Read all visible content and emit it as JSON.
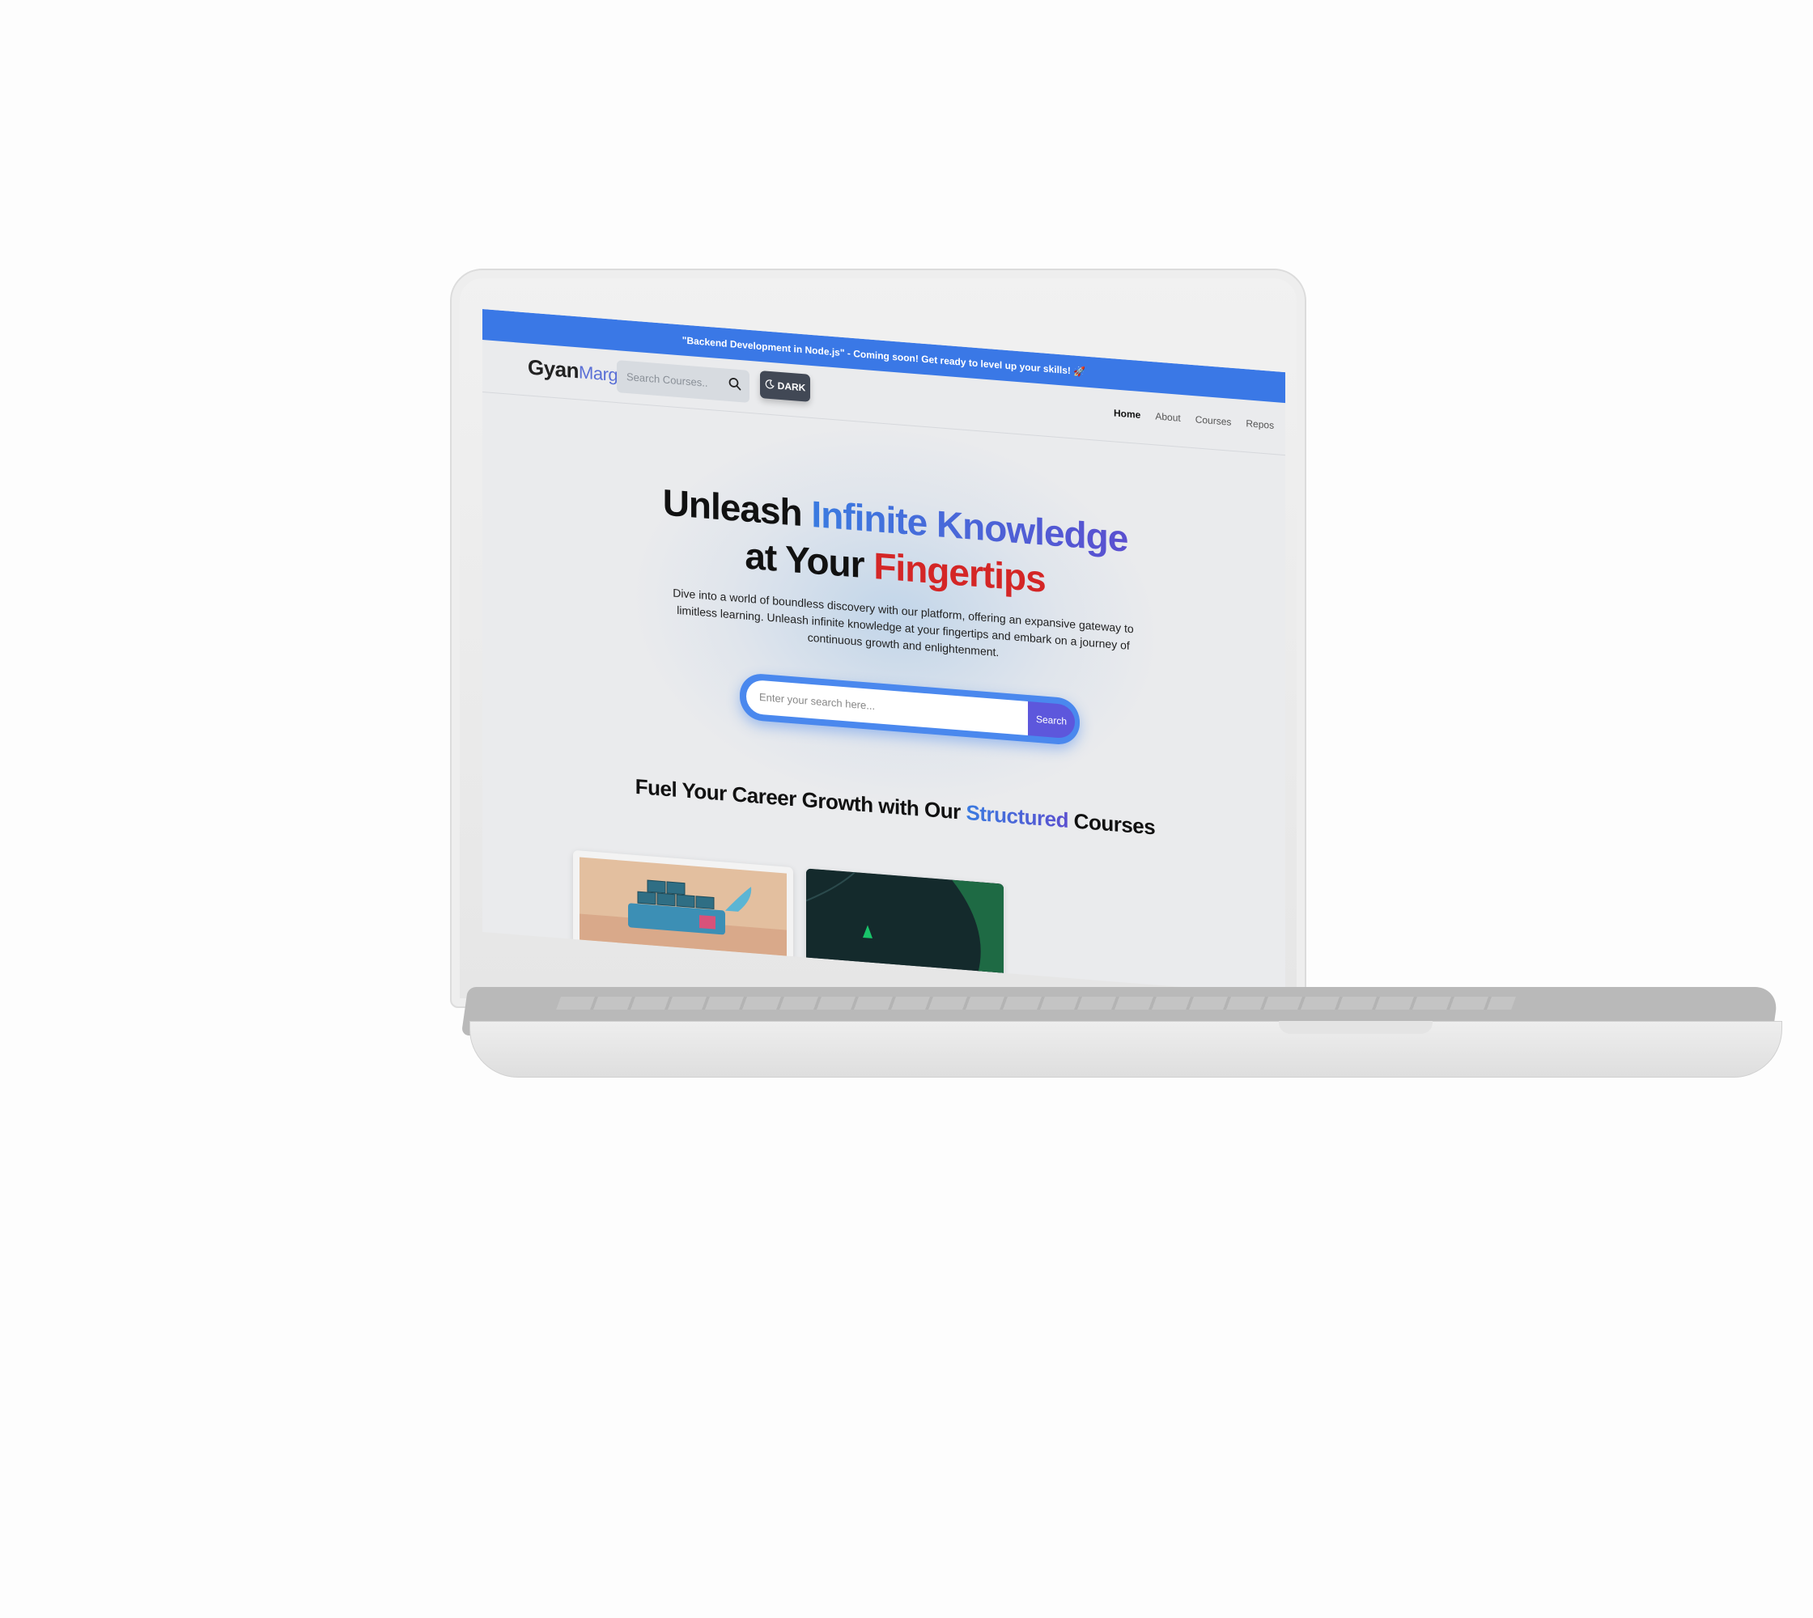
{
  "announcement": "\"Backend Development in Node.js\" - Coming soon! Get ready to level up your skills! 🚀",
  "logo": {
    "primary": "Gyan",
    "secondary": "Marg"
  },
  "nav_search": {
    "placeholder": "Search Courses.."
  },
  "theme_toggle": {
    "label": "DARK"
  },
  "nav": {
    "home": "Home",
    "about": "About",
    "courses": "Courses",
    "repos": "Repos"
  },
  "hero": {
    "title_part1": "Unleash ",
    "title_highlight1": "Infinite Knowledge",
    "title_part2": "at Your ",
    "title_highlight2": "Fingertips",
    "description": "Dive into a world of boundless discovery with our platform, offering an expansive gateway to limitless learning. Unleash infinite knowledge at your fingertips and embark on a journey of continuous growth and enlightenment.",
    "search_placeholder": "Enter your search here...",
    "search_button": "Search"
  },
  "courses_section": {
    "title_part1": "Fuel Your Career Growth with Our ",
    "title_highlight": "Structured",
    "title_part2": " Courses"
  },
  "colors": {
    "announcement_bg": "#3a78e6",
    "accent_blue": "#3a7be0",
    "accent_purple": "#5a4fd0",
    "accent_red": "#d42626",
    "dark_button": "#414855"
  }
}
